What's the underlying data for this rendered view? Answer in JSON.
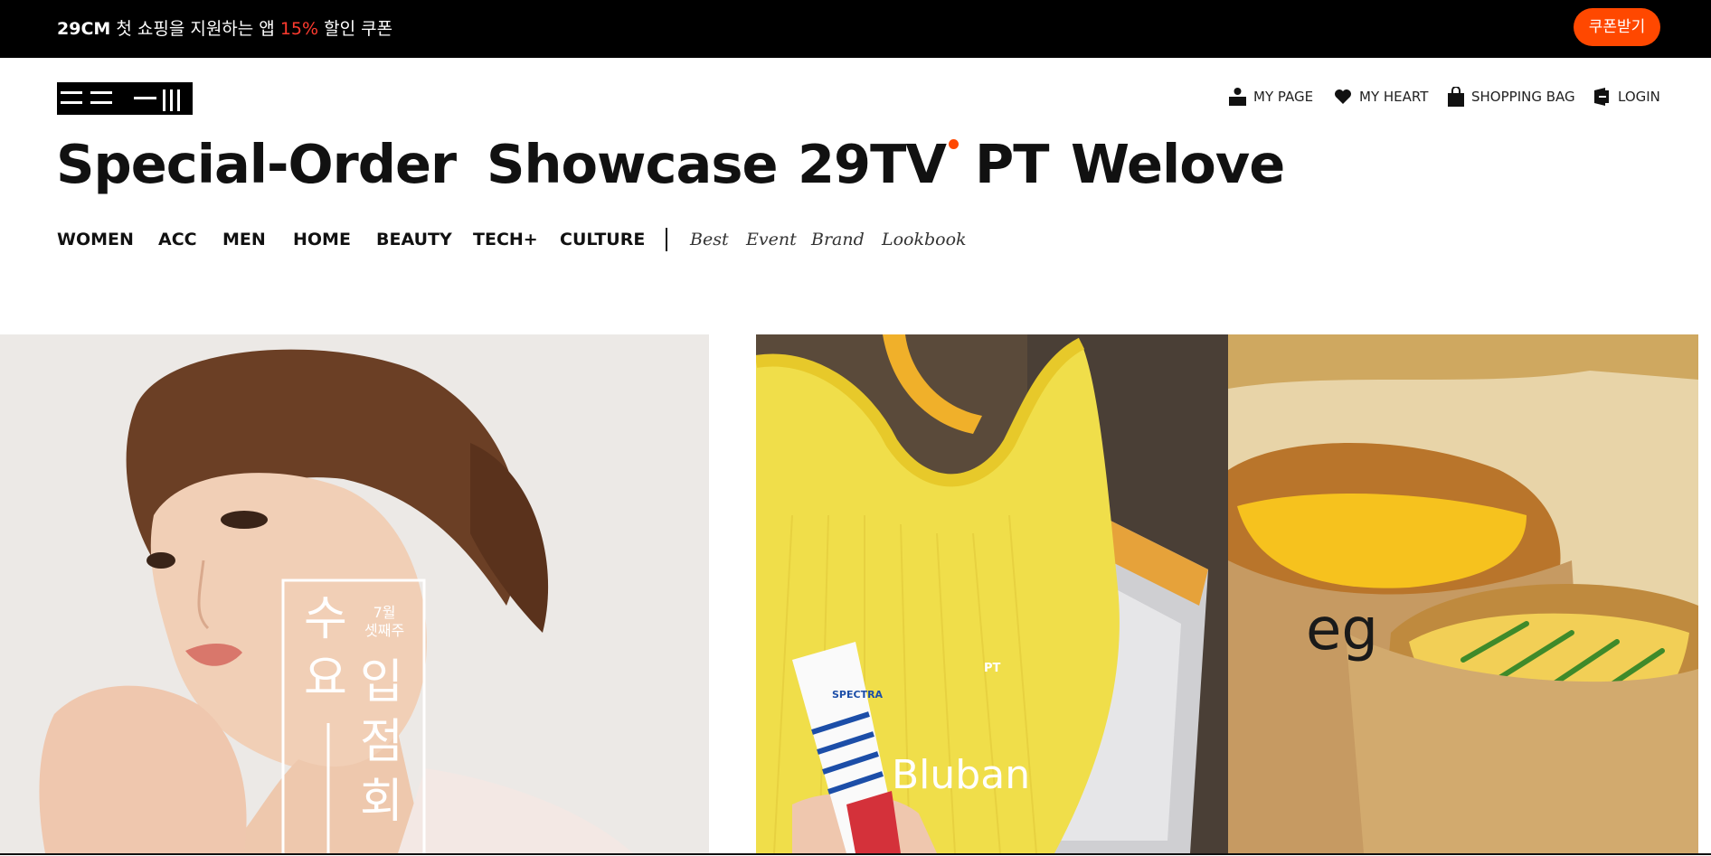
{
  "promo": {
    "brand": "29CM",
    "text_before": " 첫 쇼핑을 지원하는 앱 ",
    "percent": "15%",
    "text_after": " 할인 쿠폰",
    "button_label": "쿠폰받기",
    "accent": "#ff4800"
  },
  "utility_nav": [
    {
      "label": "MY PAGE",
      "icon": "user-icon"
    },
    {
      "label": "MY HEART",
      "icon": "heart-icon"
    },
    {
      "label": "SHOPPING BAG",
      "icon": "bag-icon"
    },
    {
      "label": "LOGIN",
      "icon": "login-icon"
    }
  ],
  "headline_nav": [
    "Special-Order",
    "Showcase",
    "29TV",
    "PT",
    "Welove"
  ],
  "categories": [
    "WOMEN",
    "ACC",
    "MEN",
    "HOME",
    "BEAUTY",
    "TECH+",
    "CULTURE"
  ],
  "sub_links": [
    "Best",
    "Event",
    "Brand",
    "Lookbook"
  ],
  "banners": {
    "left": {
      "month": "7월",
      "week": "셋째주",
      "col1": "수요",
      "col2": "입점회"
    },
    "middle": {
      "tag": "PT",
      "product_text": "SPECTRA",
      "brand": "Bluban"
    },
    "right": {
      "brand": "eg"
    }
  }
}
